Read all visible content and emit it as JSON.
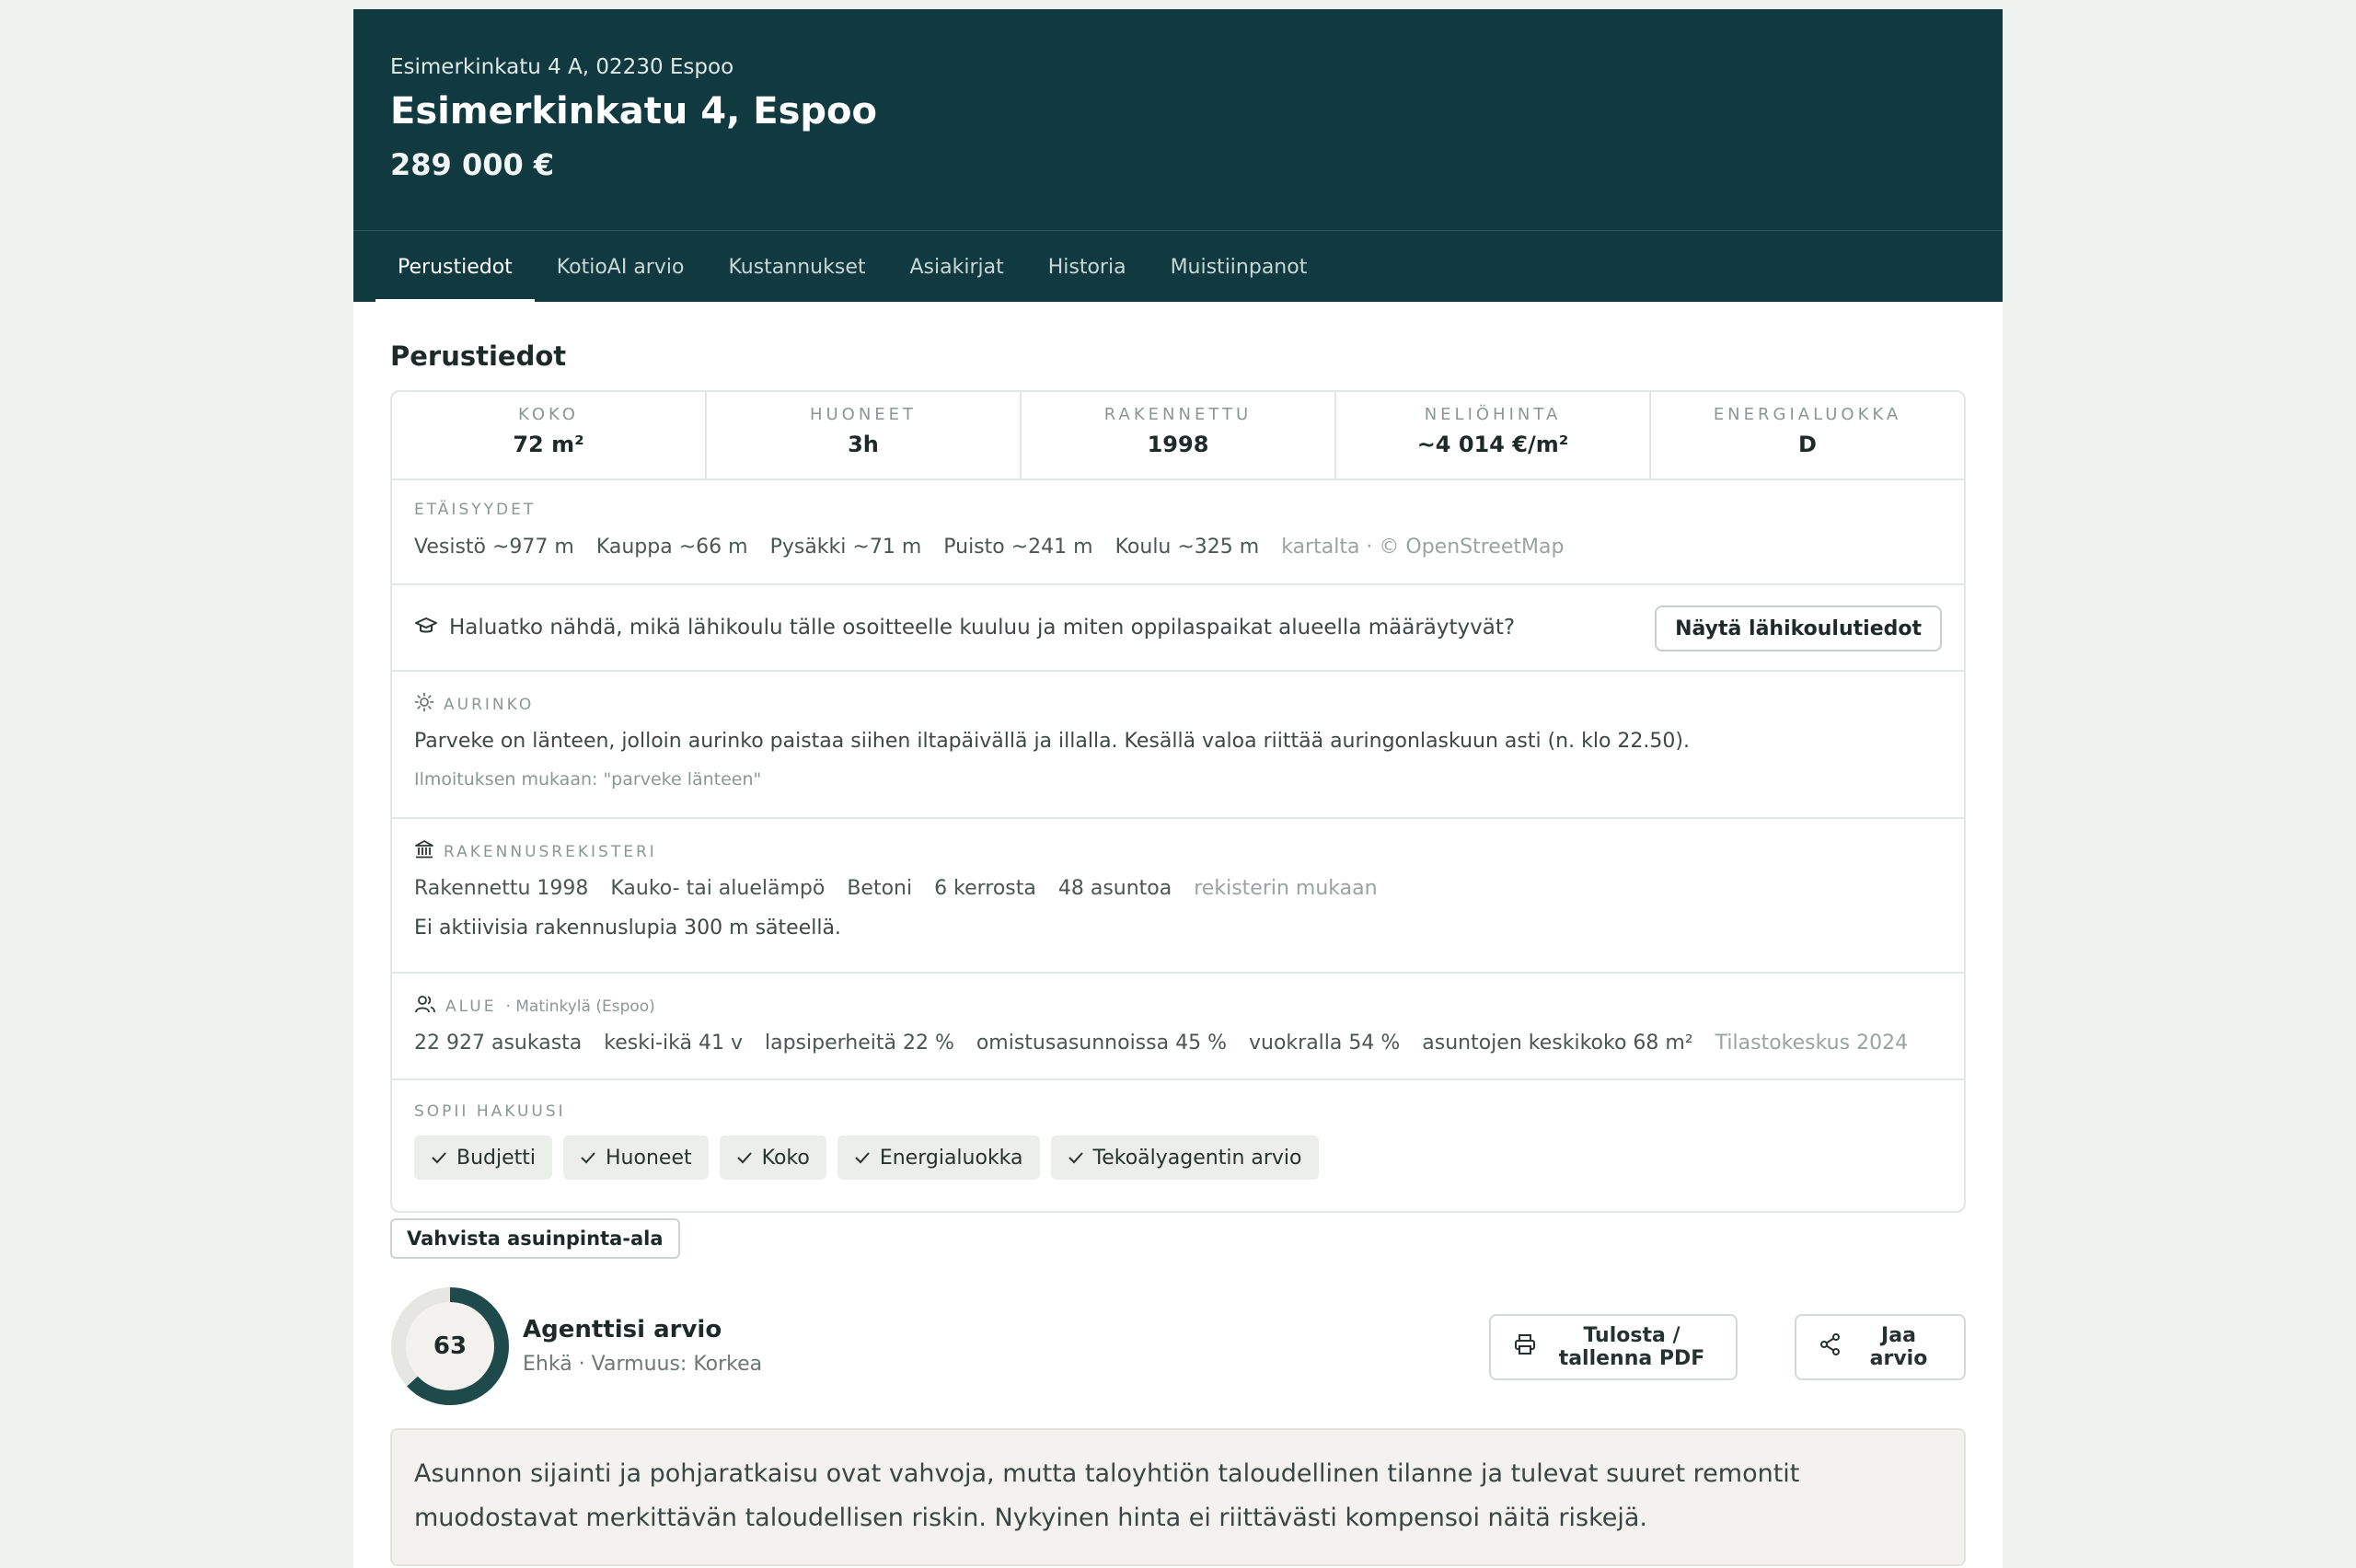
{
  "header": {
    "address": "Esimerkinkatu 4 A, 02230 Espoo",
    "title": "Esimerkinkatu 4, Espoo",
    "price": "289 000 €"
  },
  "tabs": [
    {
      "label": "Perustiedot",
      "active": true
    },
    {
      "label": "KotioAI arvio"
    },
    {
      "label": "Kustannukset"
    },
    {
      "label": "Asiakirjat"
    },
    {
      "label": "Historia"
    },
    {
      "label": "Muistiinpanot"
    }
  ],
  "section_title": "Perustiedot",
  "stats": [
    {
      "label": "KOKO",
      "value": "72 m²"
    },
    {
      "label": "HUONEET",
      "value": "3h"
    },
    {
      "label": "RAKENNETTU",
      "value": "1998"
    },
    {
      "label": "NELIÖHINTA",
      "value": "~4 014 €/m²"
    },
    {
      "label": "ENERGIALUOKKA",
      "value": "D"
    }
  ],
  "distances": {
    "label": "ETÄISYYDET",
    "items": [
      "Vesistö ~977 m",
      "Kauppa ~66 m",
      "Pysäkki ~71 m",
      "Puisto ~241 m",
      "Koulu ~325 m"
    ],
    "source": "kartalta · © OpenStreetMap"
  },
  "school": {
    "question": "Haluatko nähdä, mikä lähikoulu tälle osoitteelle kuuluu ja miten oppilaspaikat alueella määräytyvät?",
    "button": "Näytä lähikoulutiedot"
  },
  "sun": {
    "label": "AURINKO",
    "text": "Parveke on länteen, jolloin aurinko paistaa siihen iltapäivällä ja illalla. Kesällä valoa riittää auringonlaskuun asti (n. klo 22.50).",
    "note": "Ilmoituksen mukaan: \"parveke länteen\""
  },
  "register": {
    "label": "RAKENNUSREKISTERI",
    "items": [
      "Rakennettu 1998",
      "Kauko- tai aluelämpö",
      "Betoni",
      "6 kerrosta",
      "48 asuntoa"
    ],
    "source": "rekisterin mukaan",
    "note": "Ei aktiivisia rakennuslupia 300 m säteellä."
  },
  "area": {
    "label": "ALUE",
    "sub": "· Matinkylä (Espoo)",
    "items": [
      "22 927 asukasta",
      "keski-ikä 41 v",
      "lapsiperheitä 22 %",
      "omistusasunnoissa 45 %",
      "vuokralla 54 %",
      "asuntojen keskikoko 68 m²"
    ],
    "source": "Tilastokeskus 2024"
  },
  "match": {
    "label": "SOPII HAKUUSI",
    "chips": [
      "Budjetti",
      "Huoneet",
      "Koko",
      "Energialuokka",
      "Tekoälyagentin arvio"
    ]
  },
  "confirm_button": "Vahvista asuinpinta-ala",
  "agent": {
    "score": "63",
    "score_fraction": 0.63,
    "title": "Agenttisi arvio",
    "subtitle": "Ehkä · Varmuus: Korkea",
    "print_button": "Tulosta / tallenna PDF",
    "share_button": "Jaa arvio",
    "summary": "Asunnon sijainti ja pohjaratkaisu ovat vahvoja, mutta taloyhtiön taloudellinen tilanne ja tulevat suuret remontit muodostavat merkittävän taloudellisen riskin. Nykyinen hinta ei riittävästi kompensoi näitä riskejä."
  },
  "colors": {
    "header_bg": "#113a40",
    "accent": "#1f4a4c",
    "donut_track": "#e6e6e2"
  }
}
